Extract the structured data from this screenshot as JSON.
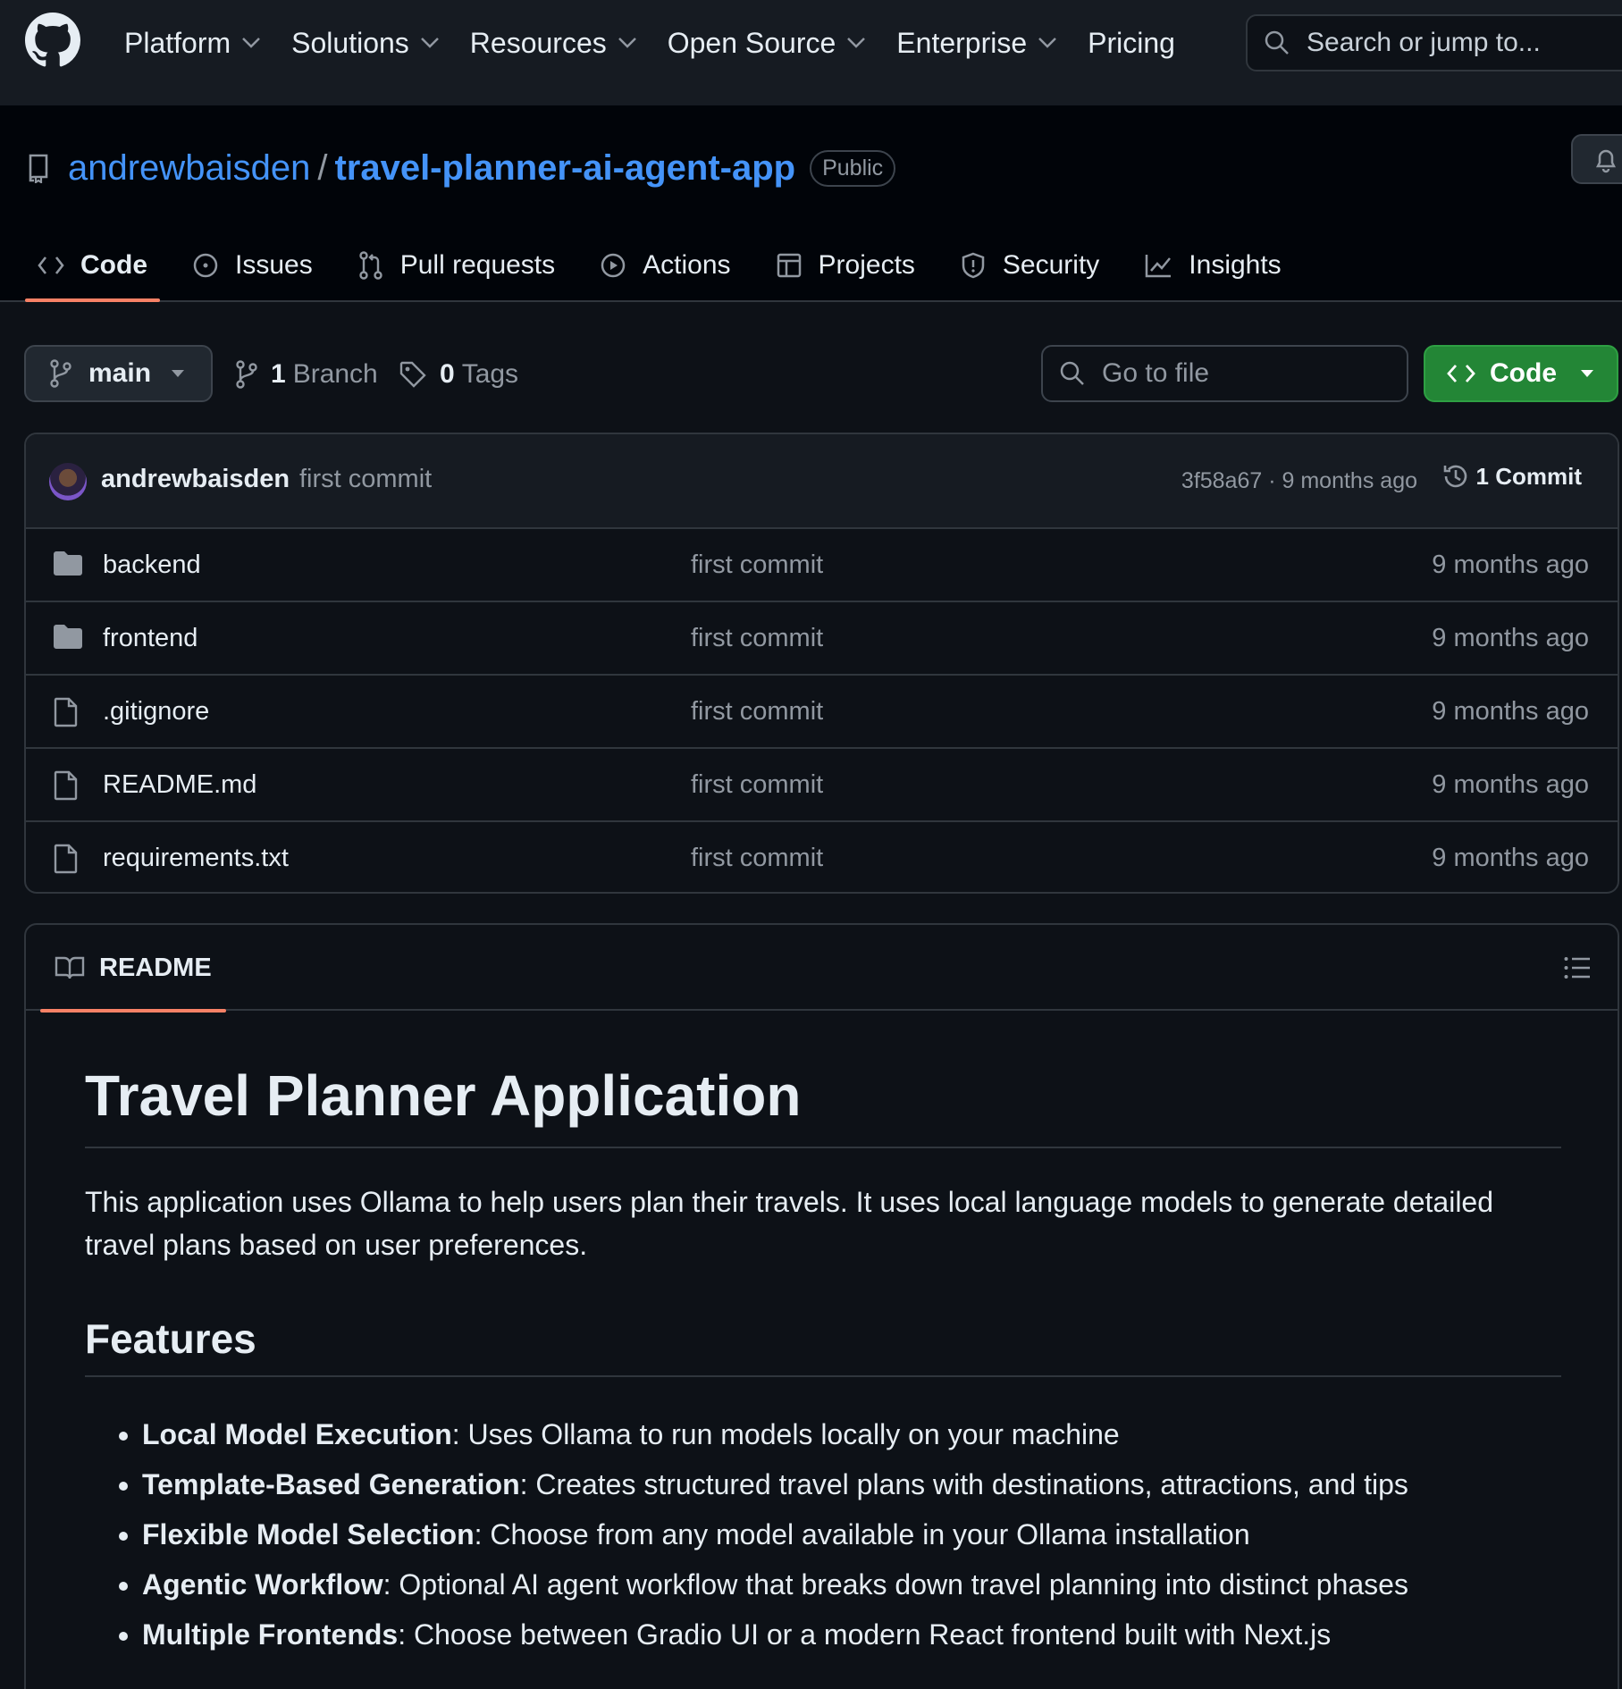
{
  "header": {
    "nav": [
      "Platform",
      "Solutions",
      "Resources",
      "Open Source",
      "Enterprise",
      "Pricing"
    ],
    "search_placeholder": "Search or jump to..."
  },
  "repo": {
    "owner": "andrewbaisden",
    "separator": "/",
    "name": "travel-planner-ai-agent-app",
    "visibility": "Public",
    "tabs": [
      {
        "label": "Code",
        "icon": "code-icon",
        "active": true
      },
      {
        "label": "Issues",
        "icon": "issue-icon"
      },
      {
        "label": "Pull requests",
        "icon": "pull-request-icon"
      },
      {
        "label": "Actions",
        "icon": "play-icon"
      },
      {
        "label": "Projects",
        "icon": "table-icon"
      },
      {
        "label": "Security",
        "icon": "shield-icon"
      },
      {
        "label": "Insights",
        "icon": "graph-icon"
      }
    ]
  },
  "toolbar": {
    "branch": "main",
    "branch_count": "1",
    "branch_label": "Branch",
    "tag_count": "0",
    "tag_label": "Tags",
    "goto_placeholder": "Go to file",
    "code_label": "Code"
  },
  "latest_commit": {
    "author": "andrewbaisden",
    "message": "first commit",
    "meta": "3f58a67 · 9 months ago",
    "count_label": "1 Commit"
  },
  "files": [
    {
      "name": "backend",
      "type": "dir",
      "commit": "first commit",
      "age": "9 months ago"
    },
    {
      "name": "frontend",
      "type": "dir",
      "commit": "first commit",
      "age": "9 months ago"
    },
    {
      "name": ".gitignore",
      "type": "file",
      "commit": "first commit",
      "age": "9 months ago"
    },
    {
      "name": "README.md",
      "type": "file",
      "commit": "first commit",
      "age": "9 months ago"
    },
    {
      "name": "requirements.txt",
      "type": "file",
      "commit": "first commit",
      "age": "9 months ago"
    }
  ],
  "readme": {
    "tab_label": "README",
    "title": "Travel Planner Application",
    "intro": "This application uses Ollama to help users plan their travels. It uses local language models to generate detailed travel plans based on user preferences.",
    "features_heading": "Features",
    "features": [
      {
        "name": "Local Model Execution",
        "text": ": Uses Ollama to run models locally on your machine"
      },
      {
        "name": "Template-Based Generation",
        "text": ": Creates structured travel plans with destinations, attractions, and tips"
      },
      {
        "name": "Flexible Model Selection",
        "text": ": Choose from any model available in your Ollama installation"
      },
      {
        "name": "Agentic Workflow",
        "text": ": Optional AI agent workflow that breaks down travel planning into distinct phases"
      },
      {
        "name": "Multiple Frontends",
        "text": ": Choose between Gradio UI or a modern React frontend built with Next.js"
      }
    ]
  },
  "colors": {
    "accent_link": "#4493f8",
    "tab_underline": "#f78166",
    "code_button": "#238636",
    "muted": "#9198a1"
  }
}
